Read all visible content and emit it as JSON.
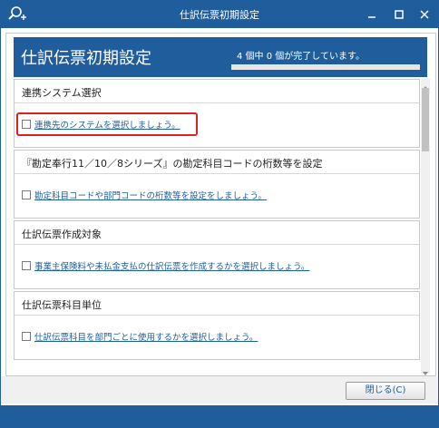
{
  "window": {
    "title": "仕訳伝票初期設定",
    "controls": {
      "minimize_icon": "minimize-icon",
      "maximize_icon": "maximize-icon",
      "close_icon": "close-icon"
    },
    "title_icon": "search-plus-icon"
  },
  "header": {
    "title": "仕訳伝票初期設定",
    "progress_text": "4 個中 0 個が完了しています。",
    "progress_fraction": 0
  },
  "sections": [
    {
      "title": "連携システム選択",
      "task": "連携先のシステムを選択しましょう。",
      "checked": false,
      "highlighted": true
    },
    {
      "title": "『勘定奉行11／10／8シリーズ』の勘定科目コードの桁数等を設定",
      "task": "勘定科目コードや部門コードの桁数等を設定をしましょう。",
      "checked": false,
      "highlighted": false
    },
    {
      "title": "仕訳伝票作成対象",
      "task": "事業主保険料や未払金支払の仕訳伝票を作成するかを選択しましょう。",
      "checked": false,
      "highlighted": false
    },
    {
      "title": "仕訳伝票科目単位",
      "task": "仕訳伝票科目を部門ごとに使用するかを選択しましょう。",
      "checked": false,
      "highlighted": false
    }
  ],
  "footer": {
    "close_label": "閉じる(C)"
  },
  "colors": {
    "brand": "#1f5d9c",
    "link": "#1f5d9c",
    "highlight": "#e02020"
  }
}
